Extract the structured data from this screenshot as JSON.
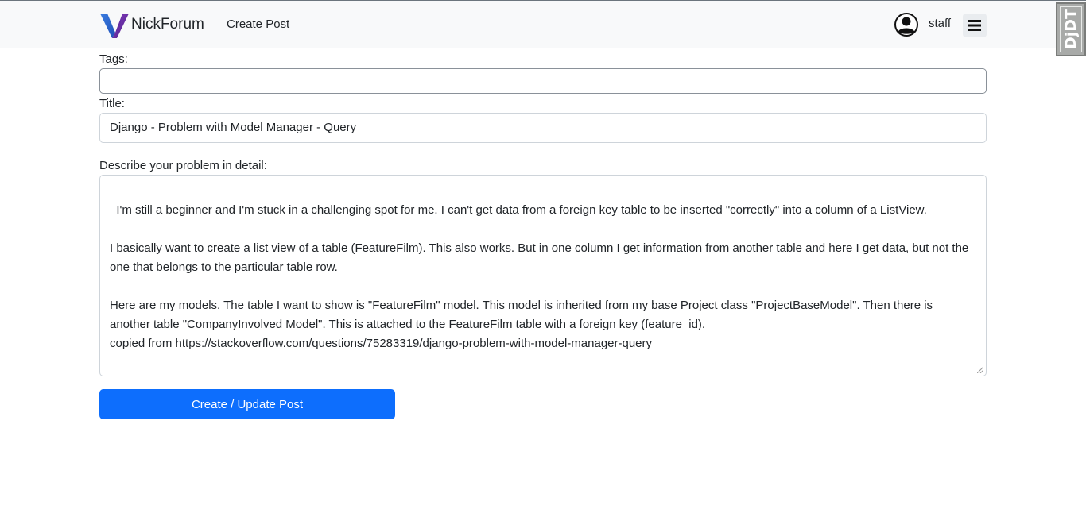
{
  "navbar": {
    "brand_name": "NickForum",
    "create_post_link": "Create Post",
    "username": "staff",
    "logo_icon": "v-logo-icon",
    "avatar_icon": "user-avatar-icon",
    "menu_icon": "hamburger-menu-icon"
  },
  "extension_badge": {
    "text": "DjDT"
  },
  "form": {
    "tags_label": "Tags:",
    "tags_value": "",
    "title_label": "Title:",
    "title_value": "Django - Problem with Model Manager - Query",
    "body_label": "Describe your problem in detail:",
    "body_value": "I'm still a beginner and I'm stuck in a challenging spot for me. I can't get data from a foreign key table to be inserted \"correctly\" into a column of a ListView.\n\nI basically want to create a list view of a table (FeatureFilm). This also works. But in one column I get information from another table and here I get data, but not the one that belongs to the particular table row.\n\nHere are my models. The table I want to show is \"FeatureFilm\" model. This model is inherited from my base Project class \"ProjectBaseModel\". Then there is another table \"CompanyInvolved Model\". This is attached to the FeatureFilm table with a foreign key (feature_id).\ncopied from https://stackoverflow.com/questions/75283319/django-problem-with-model-manager-query",
    "submit_label": "Create / Update Post"
  },
  "colors": {
    "primary": "#0d6efd",
    "navbar_bg": "#f8f9fa",
    "logo_blue": "#2b6cd6",
    "logo_purple": "#6a2ea8"
  }
}
